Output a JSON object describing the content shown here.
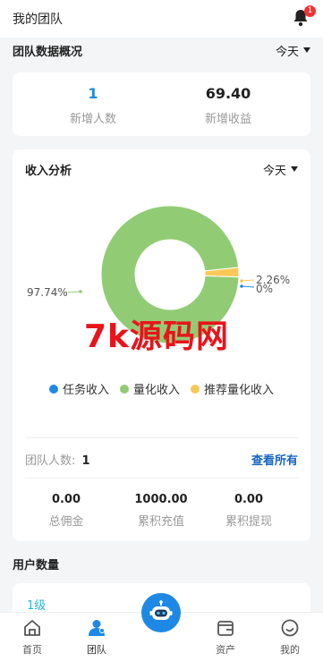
{
  "header": {
    "title": "我的团队",
    "notification_count": "1"
  },
  "overview": {
    "title": "团队数据概况",
    "period": "今天",
    "stats": [
      {
        "value": "1",
        "label": "新增人数"
      },
      {
        "value": "69.40",
        "label": "新增收益"
      }
    ]
  },
  "income": {
    "title": "收入分析",
    "period": "今天",
    "chart_data": {
      "type": "pie",
      "categories": [
        "任务收入",
        "量化收入",
        "推荐量化收入"
      ],
      "values": [
        0,
        97.74,
        2.26
      ],
      "value_labels": [
        "0%",
        "97.74%",
        "2.26%"
      ],
      "colors": [
        "#1e88e5",
        "#91cc75",
        "#fac858"
      ],
      "donut": true,
      "legend_position": "bottom"
    },
    "watermark": "7k源码网",
    "team_count_label": "团队人数:",
    "team_count": "1",
    "view_all": "查看所有",
    "totals": [
      {
        "value": "0.00",
        "label": "总佣金"
      },
      {
        "value": "1000.00",
        "label": "累积充值"
      },
      {
        "value": "0.00",
        "label": "累积提现"
      }
    ]
  },
  "users": {
    "title": "用户数量",
    "level_tab": "1级"
  },
  "tabbar": {
    "items": [
      {
        "label": "首页",
        "icon": "home-icon"
      },
      {
        "label": "团队",
        "icon": "team-icon"
      },
      {
        "label": "",
        "icon": "robot-icon"
      },
      {
        "label": "资产",
        "icon": "wallet-icon"
      },
      {
        "label": "我的",
        "icon": "profile-icon"
      }
    ],
    "active_color": "#1e88e5"
  }
}
